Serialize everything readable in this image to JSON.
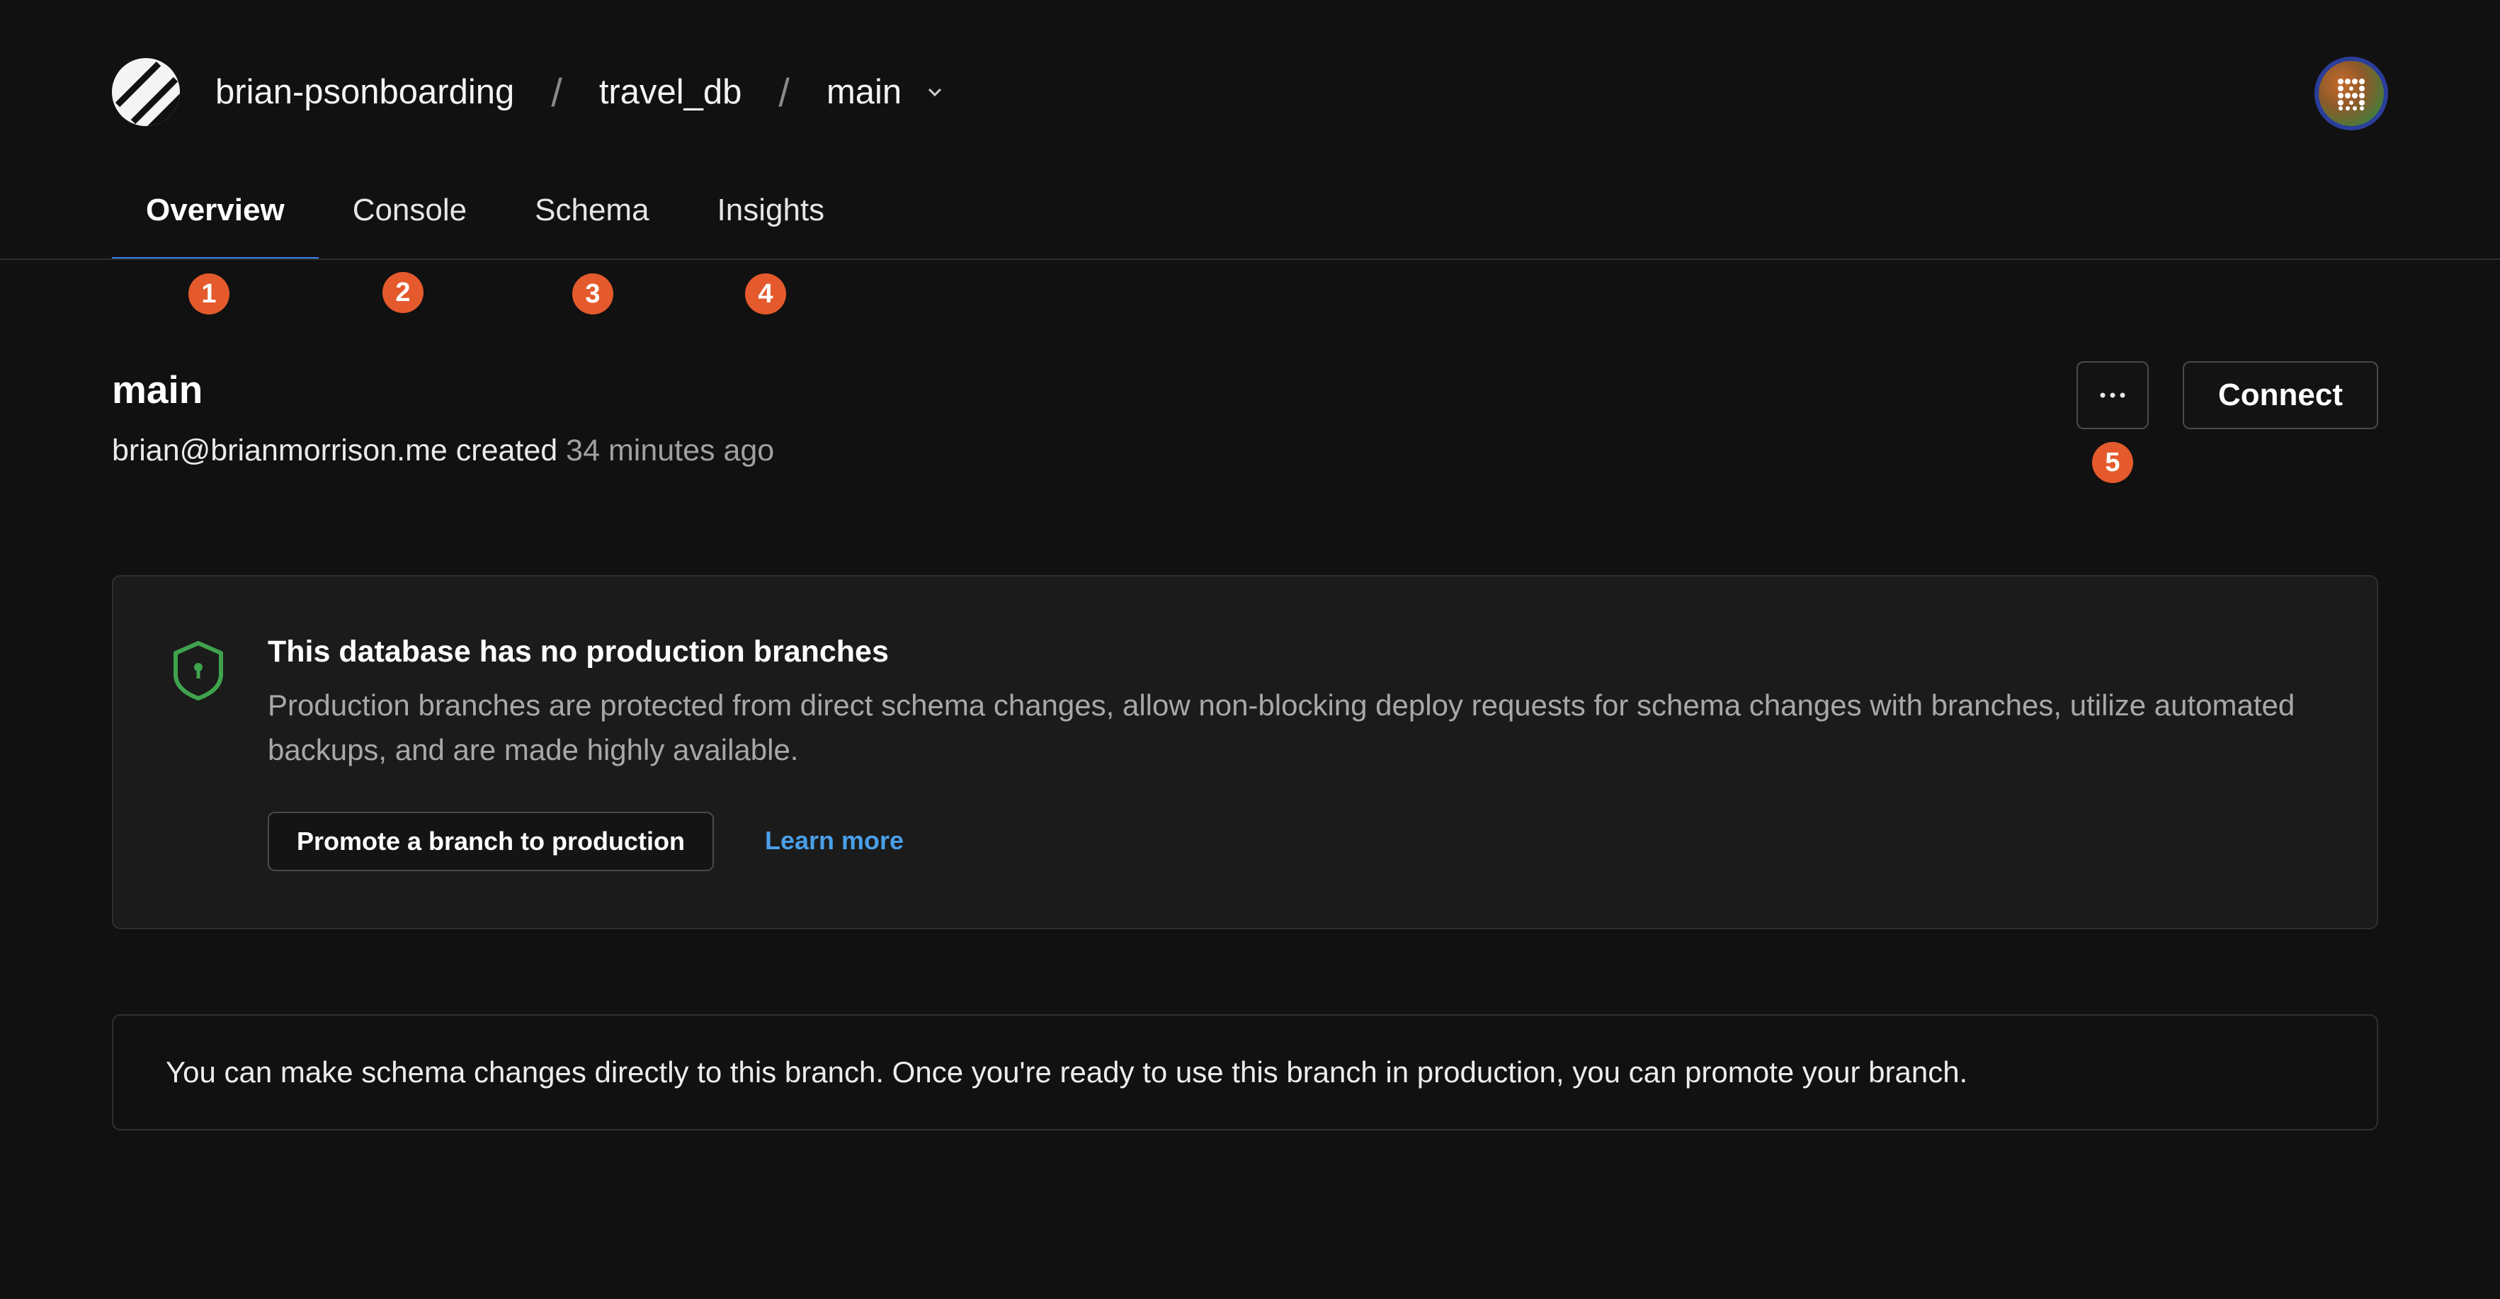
{
  "breadcrumb": {
    "org": "brian-psonboarding",
    "separator": "/",
    "database": "travel_db",
    "branch": "main"
  },
  "tabs": [
    {
      "label": "Overview",
      "active": true
    },
    {
      "label": "Console",
      "active": false
    },
    {
      "label": "Schema",
      "active": false
    },
    {
      "label": "Insights",
      "active": false
    }
  ],
  "markers": [
    "1",
    "2",
    "3",
    "4",
    "5"
  ],
  "branch": {
    "title": "main",
    "author": "brian@brianmorrison.me",
    "created_word": "created",
    "created_ago": "34 minutes ago"
  },
  "actions": {
    "more_label": "···",
    "connect_label": "Connect"
  },
  "notice": {
    "title": "This database has no production branches",
    "description": "Production branches are protected from direct schema changes, allow non-blocking deploy requests for schema changes with branches, utilize automated backups, and are made highly available.",
    "promote_label": "Promote a branch to production",
    "learn_more_label": "Learn more"
  },
  "info": {
    "text": "You can make schema changes directly to this branch. Once you're ready to use this branch in production, you can promote your branch."
  },
  "colors": {
    "background": "#111111",
    "accent_tab": "#3b7cf0",
    "marker": "#e45a2c",
    "link": "#4a9fe8",
    "shield": "#3fa34d"
  },
  "icons": {
    "logo": "planetscale-logo-icon",
    "chevron": "chevron-down-icon",
    "avatar": "user-avatar",
    "shield": "shield-icon",
    "more": "ellipsis-icon"
  }
}
